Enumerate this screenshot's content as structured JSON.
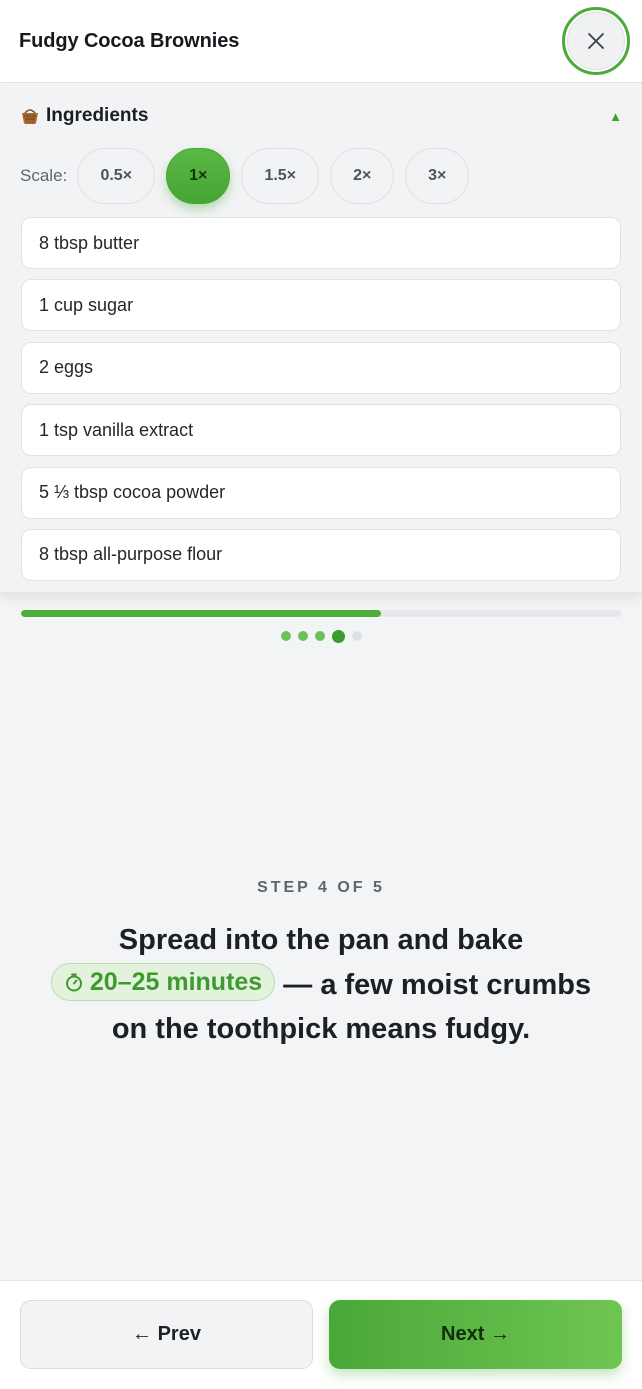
{
  "header": {
    "title": "Fudgy Cocoa Brownies",
    "close_icon": "close-icon"
  },
  "ingredients": {
    "title": "Ingredients",
    "icon": "basket-icon",
    "collapse_icon": "triangle-up-icon",
    "scale_label": "Scale:",
    "scale_options": [
      "0.5×",
      "1×",
      "1.5×",
      "2×",
      "3×"
    ],
    "selected_scale": "1×",
    "items": [
      "8 tbsp butter",
      "1 cup sugar",
      "2 eggs",
      "1 tsp vanilla extract",
      "5 ⅓ tbsp cocoa powder",
      "8 tbsp all-purpose flour"
    ]
  },
  "progress": {
    "current_step": 4,
    "total_steps": 5,
    "fill_fraction": 0.6
  },
  "step": {
    "label": "STEP 4 OF 5",
    "text_before": "Spread into the pan and bake",
    "timer_icon": "stopwatch-icon",
    "timer_text": "20–25 minutes",
    "text_after": "— a few moist crumbs on the toothpick means fudgy."
  },
  "footer": {
    "prev_label": "← Prev",
    "next_label": "Next →"
  },
  "colors": {
    "accent": "#4caf3b",
    "accent_dark": "#3d9a2e",
    "background": "#f3f4f6"
  }
}
